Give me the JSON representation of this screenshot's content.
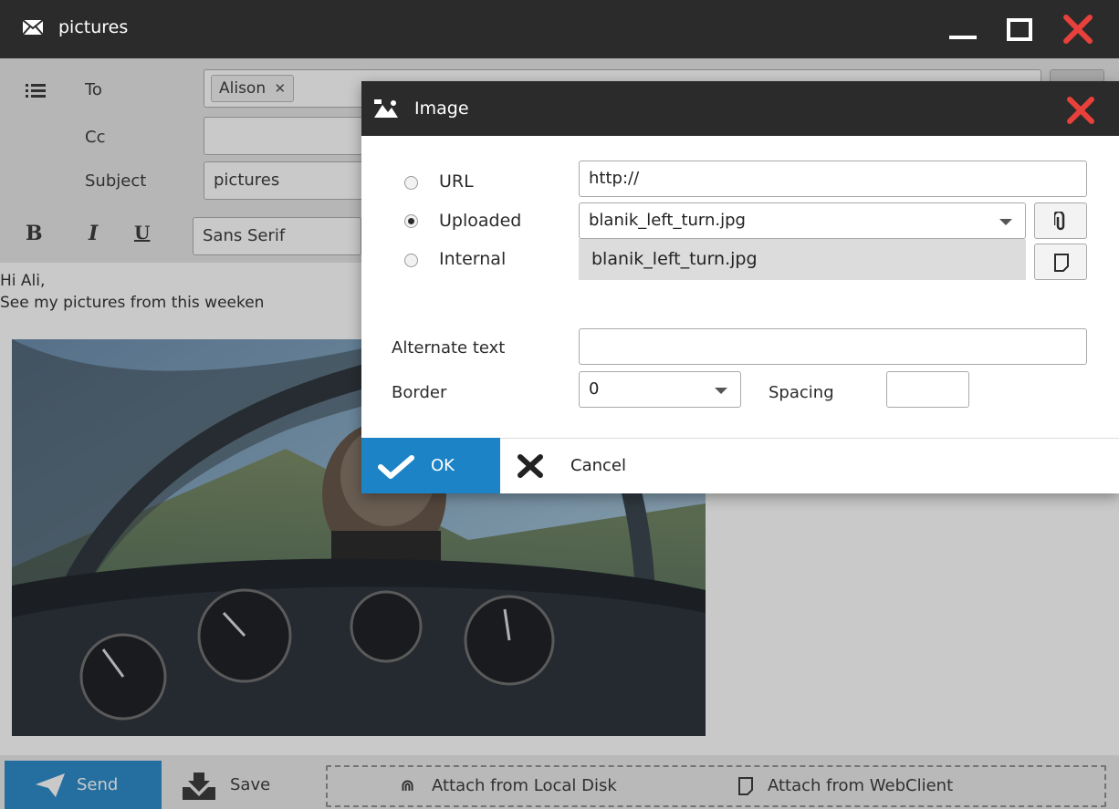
{
  "window": {
    "title": "pictures"
  },
  "compose": {
    "to_label": "To",
    "cc_label": "Cc",
    "subject_label": "Subject",
    "recipient_chip": "Alison",
    "subject_value": "pictures",
    "font_value": "Sans Serif",
    "bold_label": "B",
    "italic_label": "I",
    "underline_label": "U",
    "body_line1": "Hi Ali,",
    "body_line2": "See my pictures from this weeken"
  },
  "dialog": {
    "title": "Image",
    "url_label": "URL",
    "uploaded_label": "Uploaded",
    "internal_label": "Internal",
    "url_value": "http://",
    "uploaded_value": "blanik_left_turn.jpg",
    "dropdown_option": "blanik_left_turn.jpg",
    "alt_label": "Alternate text",
    "alt_value": "",
    "border_label": "Border",
    "border_value": "0",
    "spacing_label": "Spacing",
    "spacing_value": "",
    "ok_label": "OK",
    "cancel_label": "Cancel",
    "selected_source": "Uploaded"
  },
  "bottombar": {
    "send_label": "Send",
    "save_label": "Save",
    "attach_local_label": "Attach from Local Disk",
    "attach_webclient_label": "Attach from WebClient"
  },
  "colors": {
    "accent": "#1c83c6",
    "close_red": "#e8403a",
    "titlebar": "#2b2b2b"
  }
}
